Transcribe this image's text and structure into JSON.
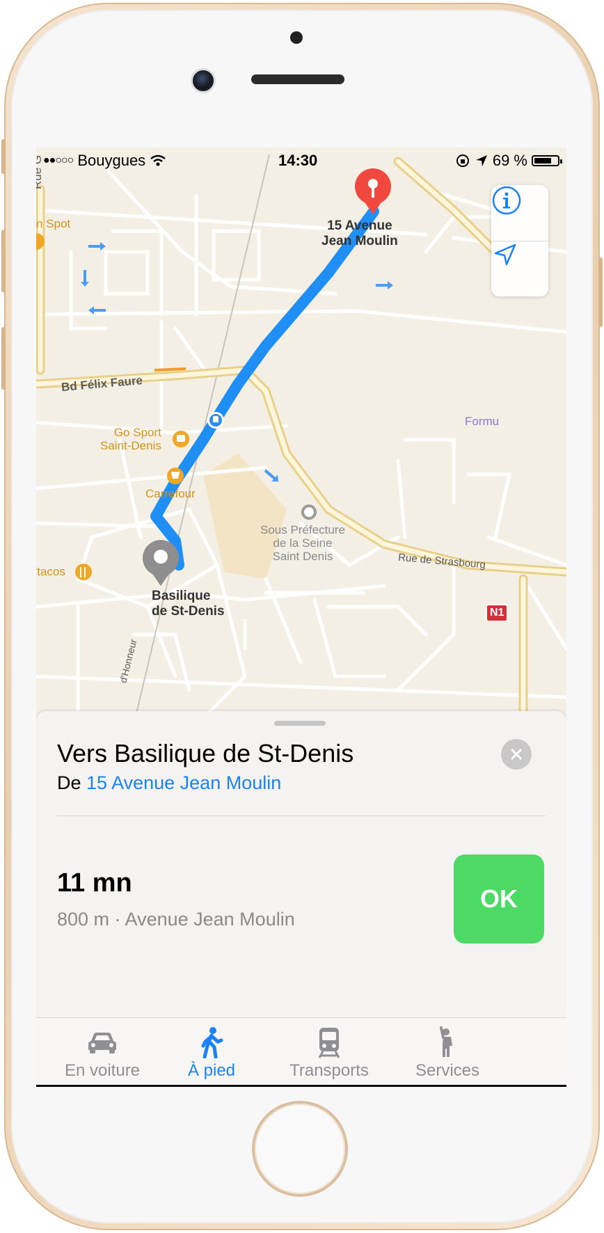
{
  "status_bar": {
    "carrier": "Bouygues",
    "time": "14:30",
    "battery": "69 %"
  },
  "map": {
    "destination_pin_label": "15 Avenue\nJean Moulin",
    "origin_pin_label": "Basilique\nde St-Denis",
    "labels": {
      "rue_g": "Rue G",
      "spot": "n Spot",
      "bd_felix_faure": "Bd Félix Faure",
      "go_sport": "Go Sport\nSaint-Denis",
      "carrefour": "Carrefour",
      "sous_prefecture": "Sous Préfecture\nde la Seine\nSaint Denis",
      "rue_strasbourg": "Rue de Strasbourg",
      "tacos": "'tacos",
      "honneur": "d'Honneur",
      "formu": "Formu",
      "n1": "N1"
    }
  },
  "card": {
    "title": "Vers Basilique de St-Denis",
    "from_prefix": "De",
    "from_link": "15 Avenue Jean Moulin",
    "duration": "11 mn",
    "detail": "800 m · Avenue Jean Moulin",
    "go_label": "OK"
  },
  "tabs": [
    {
      "label": "En voiture",
      "icon": "car-icon",
      "active": false
    },
    {
      "label": "À pied",
      "icon": "walking-icon",
      "active": true
    },
    {
      "label": "Transports",
      "icon": "train-icon",
      "active": false
    },
    {
      "label": "Services",
      "icon": "hailing-icon",
      "active": false
    }
  ],
  "colors": {
    "accent": "#1a82f7",
    "route": "#1f8ff5",
    "go_button": "#4cd964",
    "destination_pin": "#f0483e",
    "origin_pin": "#8e8e8e"
  }
}
